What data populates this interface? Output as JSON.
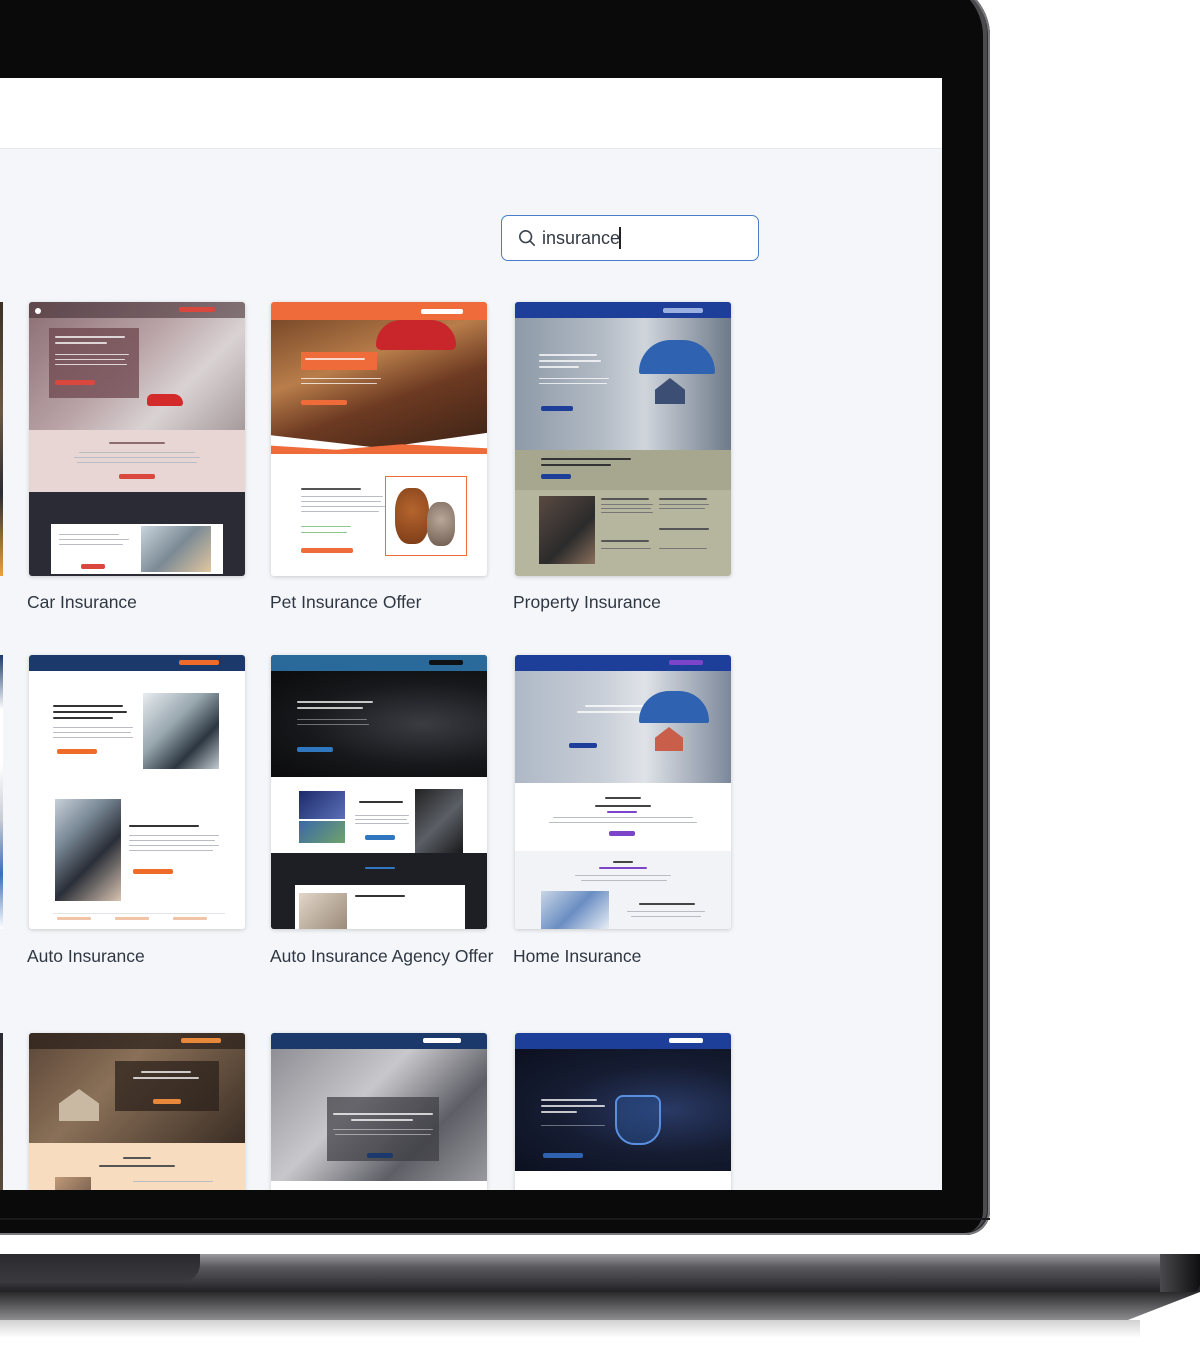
{
  "search": {
    "value": "insurance"
  },
  "templates": [
    {
      "title": "Car Insurance"
    },
    {
      "title": "Pet Insurance Offer"
    },
    {
      "title": "Property Insurance"
    },
    {
      "title": "Auto Insurance"
    },
    {
      "title": "Auto Insurance Agency Offer"
    },
    {
      "title": "Home Insurance"
    }
  ],
  "colors": {
    "search_border": "#4a7cc9",
    "screen_bg": "#f4f6f9",
    "pet_accent": "#ef6b3a",
    "property_nav": "#1d3f9a",
    "auto_nav": "#1b3a6b",
    "auto_accent": "#ef6b2a"
  }
}
